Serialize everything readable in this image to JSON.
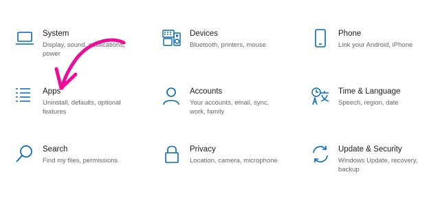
{
  "accent": "#0067c0",
  "annotation_color": "#ec0e9a",
  "tiles": [
    {
      "title": "System",
      "desc": "Display, sound, notifications, power",
      "icon": "laptop-icon"
    },
    {
      "title": "Devices",
      "desc": "Bluetooth, printers, mouse",
      "icon": "keyboard-speaker-icon"
    },
    {
      "title": "Phone",
      "desc": "Link your Android, iPhone",
      "icon": "phone-icon"
    },
    {
      "title": "Apps",
      "desc": "Uninstall, defaults, optional features",
      "icon": "apps-list-icon"
    },
    {
      "title": "Accounts",
      "desc": "Your accounts, email, sync, work, family",
      "icon": "person-icon"
    },
    {
      "title": "Time & Language",
      "desc": "Speech, region, date",
      "icon": "time-language-icon"
    },
    {
      "title": "Search",
      "desc": "Find my files, permissions",
      "icon": "search-icon"
    },
    {
      "title": "Privacy",
      "desc": "Location, camera, microphone",
      "icon": "lock-icon"
    },
    {
      "title": "Update & Security",
      "desc": "Windows Update, recovery, backup",
      "icon": "sync-arrows-icon"
    }
  ]
}
